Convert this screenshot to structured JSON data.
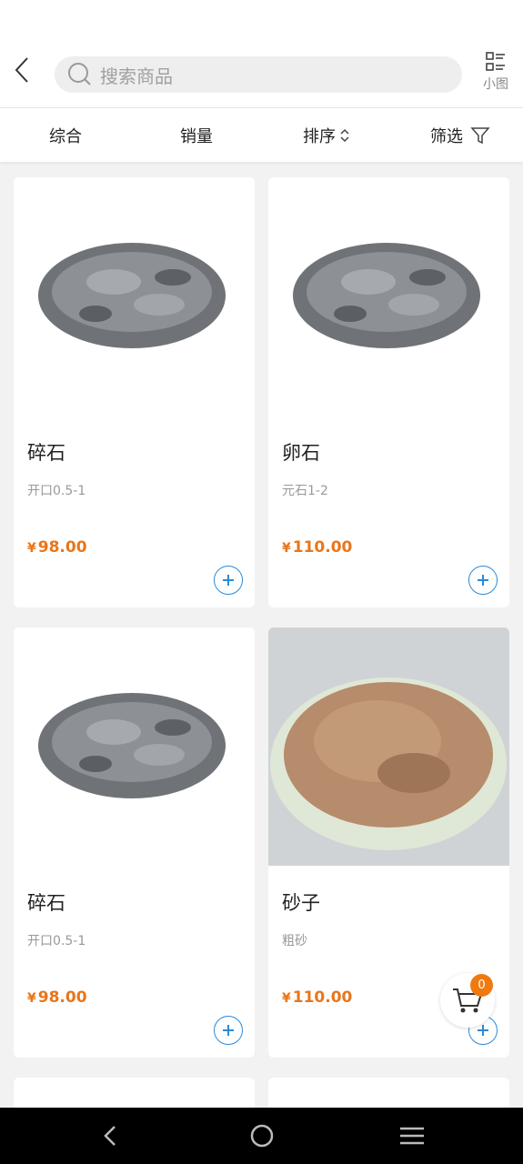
{
  "search": {
    "placeholder": "搜索商品"
  },
  "view_toggle": {
    "label": "小图"
  },
  "filters": [
    {
      "label": "综合"
    },
    {
      "label": "销量"
    },
    {
      "label": "排序"
    },
    {
      "label": "筛选"
    }
  ],
  "products": [
    {
      "name": "碎石",
      "spec": "开口0.5-1",
      "currency": "¥",
      "price": "98.00",
      "image": "crushed-gravel"
    },
    {
      "name": "卵石",
      "spec": "元石1-2",
      "currency": "¥",
      "price": "110.00",
      "image": "crushed-gravel"
    },
    {
      "name": "碎石",
      "spec": "开口0.5-1",
      "currency": "¥",
      "price": "98.00",
      "image": "crushed-gravel"
    },
    {
      "name": "砂子",
      "spec": "粗砂",
      "currency": "¥",
      "price": "110.00",
      "image": "coarse-sand-bowl"
    }
  ],
  "cart": {
    "count": "0"
  },
  "colors": {
    "price": "#e8761a",
    "accent": "#2b8ad8",
    "badge": "#f07a10"
  }
}
